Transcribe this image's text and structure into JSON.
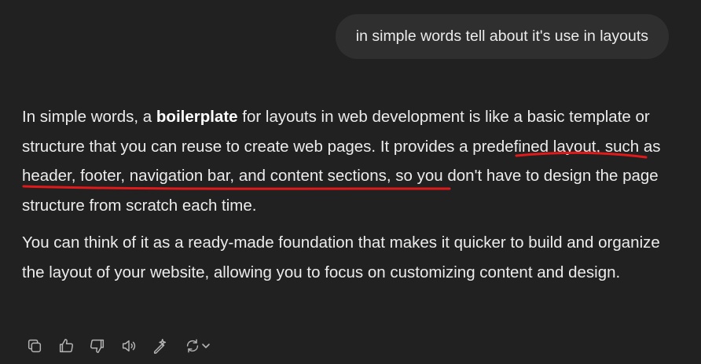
{
  "user_message": "in simple words tell about it's use in layouts",
  "assistant": {
    "p1_a": "In simple words, a ",
    "p1_bold": "boilerplate",
    "p1_b": " for layouts in web development is like a basic template or structure that you can reuse to create web pages. It provides a ",
    "p1_highlight": "predefined layout, such as header, footer, navigation bar, and content sections",
    "p1_c": ", so you don't have to design the page structure from scratch each time.",
    "p2": "You can think of it as a ready-made foundation that makes it quicker to build and organize the layout of your website, allowing you to focus on customizing content and design."
  },
  "actions": [
    "copy-icon",
    "thumbs-up-icon",
    "thumbs-down-icon",
    "read-aloud-icon",
    "edit-magic-icon",
    "regenerate-icon"
  ],
  "annotation_color": "#e0191b"
}
